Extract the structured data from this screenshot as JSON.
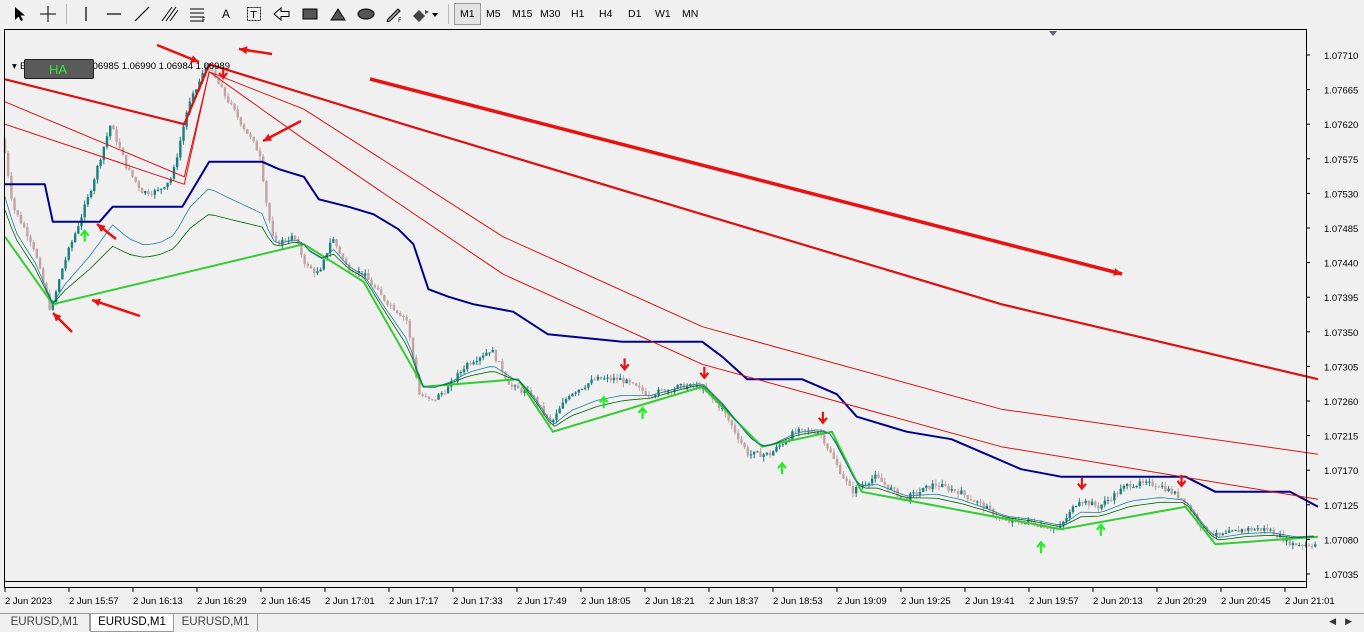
{
  "toolbar": {
    "tools": [
      {
        "name": "cursor-icon",
        "label": ""
      },
      {
        "name": "crosshair-icon",
        "label": ""
      },
      {
        "name": "vertical-line-icon",
        "label": ""
      },
      {
        "name": "horizontal-line-icon",
        "label": ""
      },
      {
        "name": "trendline-icon",
        "label": ""
      },
      {
        "name": "equidistant-channel-icon",
        "label": ""
      },
      {
        "name": "fibonacci-icon",
        "label": ""
      },
      {
        "name": "text-icon",
        "label": "A"
      },
      {
        "name": "text-label-icon",
        "label": "T"
      },
      {
        "name": "arrow-icon",
        "label": ""
      },
      {
        "name": "rectangle-icon",
        "label": ""
      },
      {
        "name": "triangle-icon",
        "label": ""
      },
      {
        "name": "ellipse-icon",
        "label": ""
      },
      {
        "name": "pencil-icon",
        "label": ""
      },
      {
        "name": "more-shapes-icon",
        "label": ""
      }
    ],
    "timeframes": [
      "M1",
      "M5",
      "M15",
      "M30",
      "H1",
      "H4",
      "D1",
      "W1",
      "MN"
    ],
    "active_timeframe": "M1"
  },
  "chart": {
    "ohlc_prefix": "E",
    "ohlc_values": ".06985 1.06990 1.06984 1.06989",
    "indicator_button": "HA",
    "colors": {
      "background": "#f0f0f0",
      "bull_candle": "#1e7f7f",
      "bear_candle": "#c4a3a3",
      "blue_line": "#00008b",
      "red_ma": "#dd1111",
      "green_ma": "#33cc33",
      "dark_green_ma": "#006400",
      "annotation_arrow": "#e81212",
      "buy_signal": "#22ee22",
      "sell_signal": "#e81212"
    }
  },
  "chart_data": {
    "type": "candlestick",
    "symbol": "EURUSD",
    "timeframe": "M1",
    "y_ticks": [
      "1.07710",
      "1.07665",
      "1.07620",
      "1.07575",
      "1.07530",
      "1.07485",
      "1.07440",
      "1.07395",
      "1.07350",
      "1.07305",
      "1.07260",
      "1.07215",
      "1.07170",
      "1.07125",
      "1.07080",
      "1.07035"
    ],
    "x_ticks": [
      "2 Jun 2023",
      "2 Jun 15:57",
      "2 Jun 16:13",
      "2 Jun 16:29",
      "2 Jun 16:45",
      "2 Jun 17:01",
      "2 Jun 17:17",
      "2 Jun 17:33",
      "2 Jun 17:49",
      "2 Jun 18:05",
      "2 Jun 18:21",
      "2 Jun 18:37",
      "2 Jun 18:53",
      "2 Jun 19:09",
      "2 Jun 19:25",
      "2 Jun 19:41",
      "2 Jun 19:57",
      "2 Jun 20:13",
      "2 Jun 20:29",
      "2 Jun 20:45",
      "2 Jun 21:01"
    ],
    "ylim": [
      1.07025,
      1.07745
    ],
    "price_path": [
      [
        0,
        1.0761
      ],
      [
        10,
        1.0752
      ],
      [
        30,
        1.0747
      ],
      [
        48,
        1.0738
      ],
      [
        60,
        1.0744
      ],
      [
        85,
        1.0753
      ],
      [
        108,
        1.0763
      ],
      [
        125,
        1.0757
      ],
      [
        140,
        1.0754
      ],
      [
        155,
        1.0754
      ],
      [
        170,
        1.0756
      ],
      [
        185,
        1.0765
      ],
      [
        205,
        1.0771
      ],
      [
        222,
        1.0767
      ],
      [
        240,
        1.0763
      ],
      [
        258,
        1.0759
      ],
      [
        265,
        1.0752
      ],
      [
        272,
        1.0747
      ],
      [
        292,
        1.0748
      ],
      [
        305,
        1.0744
      ],
      [
        318,
        1.0743
      ],
      [
        330,
        1.0748
      ],
      [
        345,
        1.0744
      ],
      [
        362,
        1.0743
      ],
      [
        380,
        1.074
      ],
      [
        405,
        1.0737
      ],
      [
        418,
        1.0727
      ],
      [
        430,
        1.0726
      ],
      [
        448,
        1.0728
      ],
      [
        465,
        1.0731
      ],
      [
        490,
        1.0733
      ],
      [
        510,
        1.0728
      ],
      [
        530,
        1.0727
      ],
      [
        550,
        1.0723
      ],
      [
        568,
        1.0727
      ],
      [
        595,
        1.0729
      ],
      [
        620,
        1.0729
      ],
      [
        648,
        1.0727
      ],
      [
        680,
        1.0728
      ],
      [
        700,
        1.0728
      ],
      [
        722,
        1.0725
      ],
      [
        748,
        1.0719
      ],
      [
        770,
        1.0719
      ],
      [
        795,
        1.0722
      ],
      [
        820,
        1.0722
      ],
      [
        835,
        1.0718
      ],
      [
        852,
        1.0714
      ],
      [
        875,
        1.0716
      ],
      [
        905,
        1.0713
      ],
      [
        935,
        1.0715
      ],
      [
        960,
        1.0714
      ],
      [
        985,
        1.0712
      ],
      [
        1005,
        1.071
      ],
      [
        1030,
        1.071
      ],
      [
        1060,
        1.0709
      ],
      [
        1080,
        1.0713
      ],
      [
        1100,
        1.0712
      ],
      [
        1130,
        1.0715
      ],
      [
        1160,
        1.0715
      ],
      [
        1185,
        1.0713
      ],
      [
        1205,
        1.0709
      ],
      [
        1220,
        1.0708
      ],
      [
        1245,
        1.0709
      ],
      [
        1270,
        1.0709
      ],
      [
        1295,
        1.0707
      ],
      [
        1318,
        1.0707
      ]
    ],
    "series": [
      {
        "name": "",
        "color": "#00008b",
        "points": [
          [
            0,
            1.0755
          ],
          [
            40,
            1.0755
          ],
          [
            48,
            1.075
          ],
          [
            95,
            1.075
          ],
          [
            108,
            1.0752
          ],
          [
            178,
            1.0752
          ],
          [
            205,
            1.0758
          ],
          [
            258,
            1.0758
          ],
          [
            275,
            1.0757
          ],
          [
            300,
            1.0756
          ],
          [
            315,
            1.0753
          ],
          [
            345,
            1.0752
          ],
          [
            370,
            1.0751
          ],
          [
            395,
            1.0749
          ],
          [
            410,
            1.0747
          ],
          [
            425,
            1.0741
          ],
          [
            445,
            1.074
          ],
          [
            470,
            1.0739
          ],
          [
            510,
            1.0738
          ],
          [
            545,
            1.0735
          ],
          [
            620,
            1.0734
          ],
          [
            700,
            1.0734
          ],
          [
            720,
            1.0732
          ],
          [
            745,
            1.0729
          ],
          [
            800,
            1.0729
          ],
          [
            835,
            1.0727
          ],
          [
            855,
            1.0724
          ],
          [
            905,
            1.0722
          ],
          [
            950,
            1.0721
          ],
          [
            985,
            1.0719
          ],
          [
            1020,
            1.0717
          ],
          [
            1060,
            1.0716
          ],
          [
            1185,
            1.0716
          ],
          [
            1215,
            1.0714
          ],
          [
            1290,
            1.0714
          ],
          [
            1318,
            1.0712
          ]
        ]
      },
      {
        "name": "",
        "color": "#dd1111",
        "points": [
          [
            0,
            1.0769
          ],
          [
            180,
            1.0763
          ],
          [
            205,
            1.0771
          ],
          [
            400,
            1.0763
          ],
          [
            700,
            1.0751
          ],
          [
            1000,
            1.0739
          ],
          [
            1318,
            1.0729
          ]
        ]
      },
      {
        "name": "",
        "color": "#dd1111",
        "points": [
          [
            0,
            1.0766
          ],
          [
            180,
            1.0756
          ],
          [
            205,
            1.077
          ],
          [
            300,
            1.0765
          ],
          [
            500,
            1.0748
          ],
          [
            700,
            1.0736
          ],
          [
            1000,
            1.0725
          ],
          [
            1318,
            1.0719
          ]
        ]
      },
      {
        "name": "",
        "color": "#dd1111",
        "points": [
          [
            0,
            1.0763
          ],
          [
            180,
            1.0755
          ],
          [
            205,
            1.077
          ],
          [
            300,
            1.0761
          ],
          [
            500,
            1.0743
          ],
          [
            700,
            1.0731
          ],
          [
            1000,
            1.072
          ],
          [
            1318,
            1.0713
          ]
        ]
      },
      {
        "name": "",
        "color": "#33cc33",
        "points": [
          [
            0,
            1.0748
          ],
          [
            48,
            1.0739
          ],
          [
            300,
            1.0747
          ],
          [
            360,
            1.0742
          ],
          [
            420,
            1.0728
          ],
          [
            515,
            1.0729
          ],
          [
            550,
            1.0722
          ],
          [
            700,
            1.0728
          ],
          [
            760,
            1.072
          ],
          [
            830,
            1.0722
          ],
          [
            860,
            1.0714
          ],
          [
            1060,
            1.0709
          ],
          [
            1185,
            1.0712
          ],
          [
            1215,
            1.0707
          ],
          [
            1318,
            1.0708
          ]
        ]
      }
    ],
    "sell_signals_x": [
      219,
      622,
      702,
      821,
      1081,
      1181
    ],
    "buy_signals_x": [
      80,
      601,
      640,
      780,
      1040,
      1100
    ]
  }
}
